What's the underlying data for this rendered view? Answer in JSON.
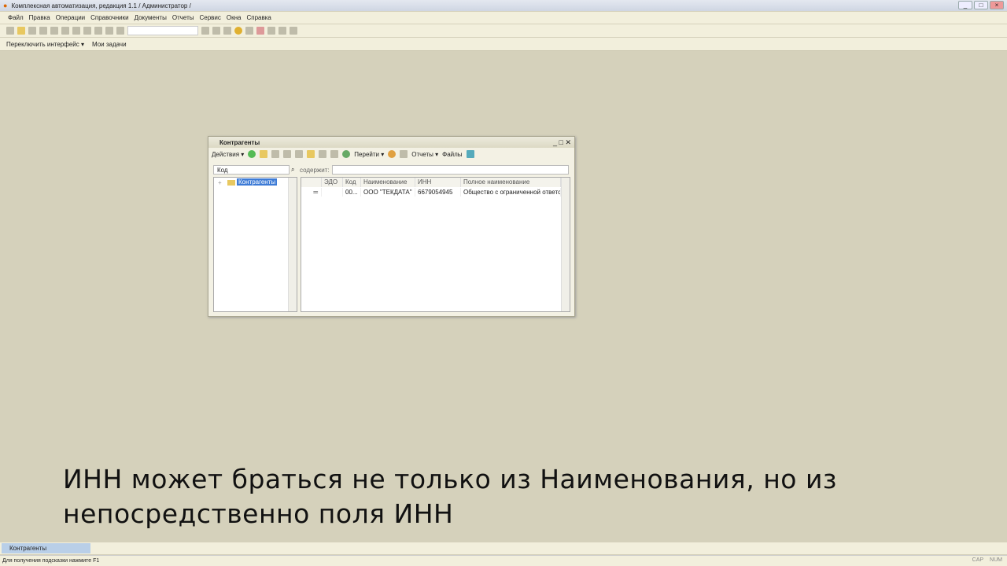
{
  "app": {
    "title": "Комплексная автоматизация, редакция 1.1 / Администратор /"
  },
  "menu": [
    "Файл",
    "Правка",
    "Операции",
    "Справочники",
    "Документы",
    "Отчеты",
    "Сервис",
    "Окна",
    "Справка"
  ],
  "toolbar2": {
    "switch": "Переключить интерфейс ▾",
    "tasks": "Мои задачи"
  },
  "window": {
    "title": "Контрагенты",
    "actions": "Действия ▾",
    "goto": "Перейти ▾",
    "reports": "Отчеты ▾",
    "files": "Файлы",
    "filter": {
      "field": "Код",
      "contains_label": "содержит:",
      "value": ""
    },
    "tree": {
      "root": "Контрагенты"
    },
    "grid": {
      "columns": [
        "",
        "ЭДО",
        "Код",
        "Наименование",
        "ИНН",
        "Полное наименование"
      ],
      "rows": [
        {
          "mark": "═",
          "edo": "",
          "code": "00...",
          "name": "ООО \"ТЕКДАТА\"",
          "inn": "6679054945",
          "full": "Общество с ограниченной ответс..."
        }
      ]
    }
  },
  "caption": {
    "line1": "ИНН может браться не только из Наименования, но из",
    "line2": "непосредственно поля ИНН"
  },
  "taskbar": {
    "item": "Контрагенты"
  },
  "status": {
    "hint": "Для получения подсказки нажмите F1",
    "cap": "CAP",
    "num": "NUM"
  }
}
